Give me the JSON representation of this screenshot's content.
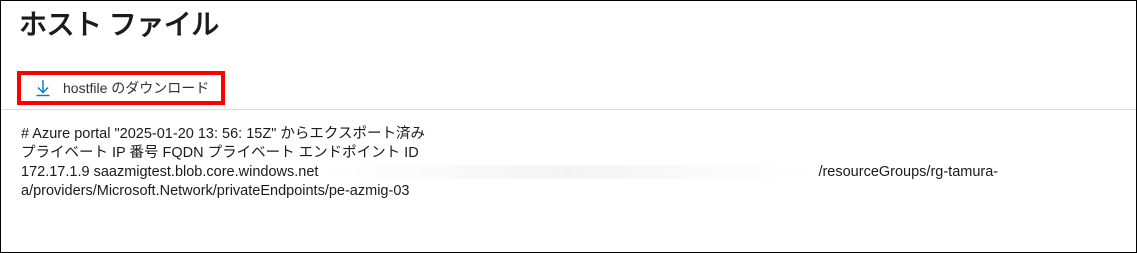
{
  "page": {
    "title": "ホスト ファイル"
  },
  "toolbar": {
    "download_label": "hostfile のダウンロード",
    "download_icon": "download-icon",
    "highlight_color": "#ff0000",
    "icon_color": "#0078d4"
  },
  "hostfile": {
    "comment": "# Azure portal \"2025-01-20 13: 56: 15Z\" からエクスポート済み",
    "header": "プライベート IP 番号 FQDN プライベート エンドポイント ID",
    "entry_ip_fqdn": "172.17.1.9 saazmigtest.blob.core.windows.net",
    "entry_id_part1": "/resourceGroups/rg-tamura-",
    "entry_id_part2": "a/providers/Microsoft.Network/privateEndpoints/pe-azmig-03"
  }
}
